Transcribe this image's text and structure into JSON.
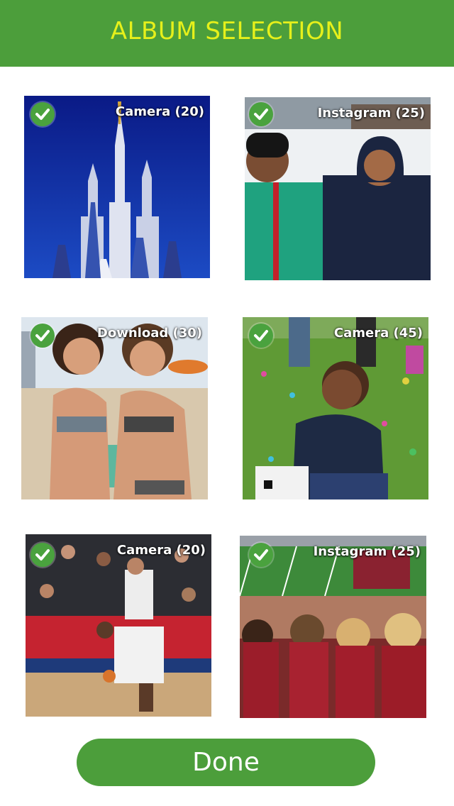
{
  "header": {
    "title": "ALBUM SELECTION"
  },
  "albums": [
    {
      "label": "Camera (20)",
      "selected": true,
      "scene": "castle against blue sky"
    },
    {
      "label": "Instagram (25)",
      "selected": true,
      "scene": "two kids in snow"
    },
    {
      "label": "Download (30)",
      "selected": true,
      "scene": "two girls at beach"
    },
    {
      "label": "Camera (45)",
      "selected": true,
      "scene": "boy on grass with easter eggs"
    },
    {
      "label": "Camera (20)",
      "selected": true,
      "scene": "basketball player on court"
    },
    {
      "label": "Instagram (25)",
      "selected": true,
      "scene": "fans at football stadium"
    }
  ],
  "footer": {
    "done_label": "Done"
  },
  "colors": {
    "header": "#4c9e3b",
    "title": "#e6f01b",
    "check": "#4aa23e",
    "button": "#4c9e3b"
  }
}
